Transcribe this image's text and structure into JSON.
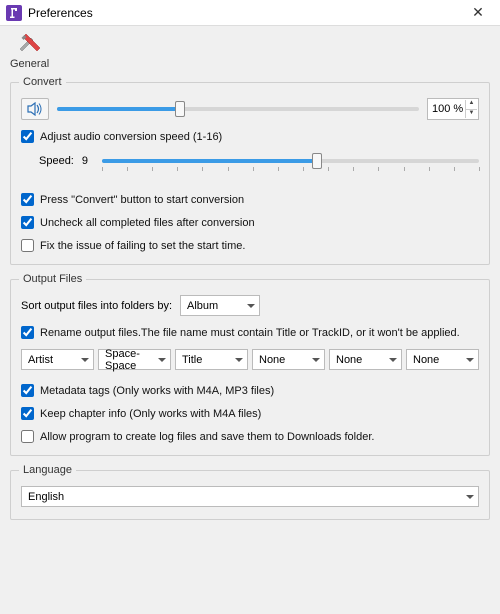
{
  "window": {
    "title": "Preferences"
  },
  "toolbar": {
    "general": "General"
  },
  "convert": {
    "legend": "Convert",
    "volume_percent": "100 %",
    "volume_fill_pct": 34,
    "adjust_speed_label": "Adjust audio conversion speed (1-16)",
    "adjust_speed_checked": true,
    "speed_label": "Speed:",
    "speed_value": "9",
    "speed_fill_pct": 57,
    "press_convert_label": "Press \"Convert\" button to start conversion",
    "press_convert_checked": true,
    "uncheck_label": "Uncheck all completed files after conversion",
    "uncheck_checked": true,
    "fix_issue_label": "Fix the issue of failing to set the start time.",
    "fix_issue_checked": false
  },
  "output": {
    "legend": "Output Files",
    "sort_label": "Sort output files into folders by:",
    "sort_value": "Album",
    "rename_label": "Rename output files.The file name must contain Title or TrackID, or it won't be applied.",
    "rename_checked": true,
    "fields": [
      "Artist",
      "Space-Space",
      "Title",
      "None",
      "None",
      "None"
    ],
    "metadata_label": "Metadata tags (Only works with M4A, MP3 files)",
    "metadata_checked": true,
    "chapter_label": "Keep chapter info (Only works with M4A files)",
    "chapter_checked": true,
    "log_label": "Allow program to create log files and save them to Downloads folder.",
    "log_checked": false
  },
  "language": {
    "legend": "Language",
    "value": "English"
  }
}
